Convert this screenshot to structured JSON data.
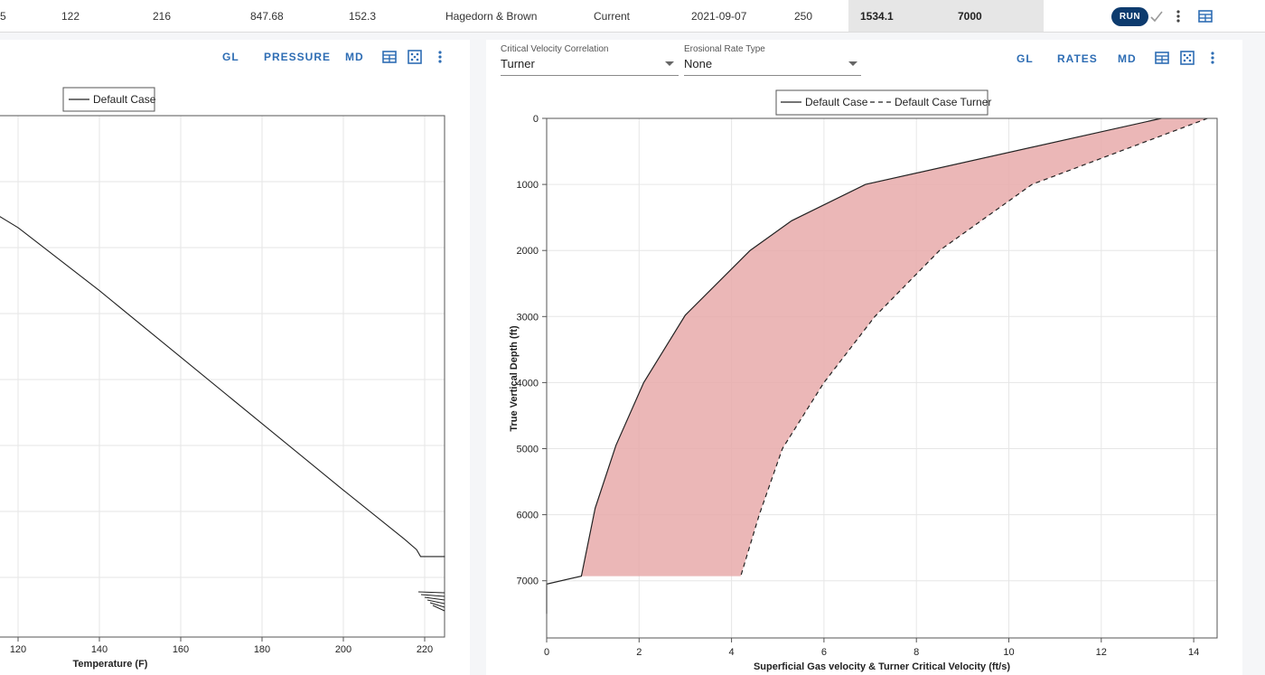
{
  "table_row": {
    "cells": [
      "5",
      "122",
      "216",
      "847.68",
      "152.3",
      "Hagedorn & Brown",
      "Current",
      "2021-09-07",
      "250",
      "1534.1",
      "7000"
    ],
    "run_label": "RUN"
  },
  "left_panel": {
    "buttons": [
      "GL",
      "PRESSURE",
      "MD"
    ],
    "chart": {
      "legend": [
        "Default Case"
      ],
      "xlabel": "Temperature (F)",
      "x_ticks": [
        "120",
        "140",
        "160",
        "180",
        "200",
        "220"
      ]
    }
  },
  "right_panel": {
    "critical_velocity": {
      "label": "Critical Velocity Correlation",
      "value": "Turner"
    },
    "erosional_rate": {
      "label": "Erosional Rate Type",
      "value": "None"
    },
    "buttons": [
      "GL",
      "RATES",
      "MD"
    ],
    "chart": {
      "legend": [
        "Default Case",
        "Default Case Turner"
      ],
      "xlabel": "Superficial Gas velocity & Turner Critical Velocity (ft/s)",
      "ylabel": "True Vertical Depth (ft)",
      "x_ticks": [
        "0",
        "2",
        "4",
        "6",
        "8",
        "10",
        "12",
        "14"
      ],
      "y_ticks": [
        "0",
        "1000",
        "2000",
        "3000",
        "4000",
        "5000",
        "6000",
        "7000"
      ]
    }
  },
  "chart_data": [
    {
      "type": "line",
      "xlabel": "Temperature (F)",
      "ylabel": "",
      "xlim": [
        115,
        225
      ],
      "series": [
        {
          "name": "Default Case",
          "x": [
            103,
            120,
            140,
            160,
            180,
            200,
            215,
            218,
            219,
            225
          ],
          "y": [
            1000,
            1600,
            2500,
            3450,
            4400,
            5350,
            6050,
            6200,
            6300,
            6300
          ]
        }
      ]
    },
    {
      "type": "area",
      "xlabel": "Superficial Gas velocity & Turner Critical Velocity (ft/s)",
      "ylabel": "True Vertical Depth (ft)",
      "xlim": [
        0,
        14.5
      ],
      "ylim": [
        0,
        7700
      ],
      "series": [
        {
          "name": "Default Case",
          "x": [
            13.3,
            6.9,
            5.3,
            4.4,
            3.0,
            2.1,
            1.5,
            1.05,
            0.75,
            0.0,
            0.0
          ],
          "y": [
            0,
            1000,
            1550,
            2000,
            2980,
            4000,
            4950,
            5900,
            6930,
            7050,
            7500
          ]
        },
        {
          "name": "Default Case Turner",
          "x": [
            14.3,
            10.5,
            8.5,
            7.1,
            6.0,
            5.1,
            4.6,
            4.2
          ],
          "y": [
            0,
            1000,
            2000,
            3000,
            4000,
            5000,
            6000,
            6930
          ]
        }
      ]
    }
  ]
}
